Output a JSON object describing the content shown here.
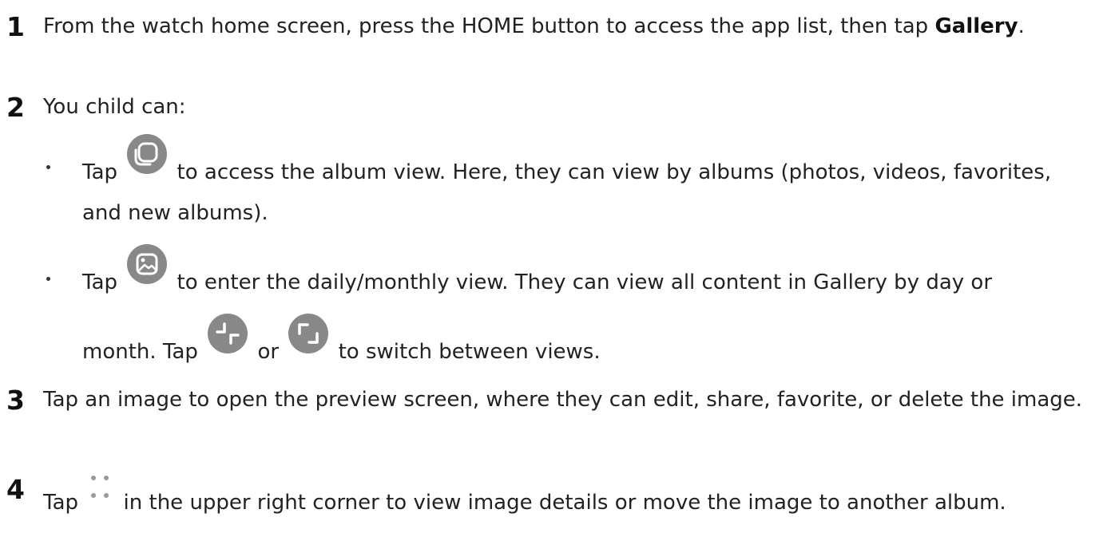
{
  "steps": [
    {
      "num": "1",
      "text_before": "From the watch home screen, press the HOME button to access the app list, then tap ",
      "bold": "Gallery",
      "text_after": "."
    },
    {
      "num": "2",
      "text": "You child can:"
    },
    {
      "num": "3",
      "text": "Tap an image to open the preview screen, where they can edit, share, favorite, or delete the image."
    },
    {
      "num": "4",
      "text_before": "Tap ",
      "text_after": " in the upper right corner to view image details or move the image to another album."
    }
  ],
  "bullets": {
    "album": {
      "tap": "Tap",
      "text": "to access the album view. Here, they can view by albums (photos, videos, favorites, and new albums)."
    },
    "daily": {
      "tap": "Tap",
      "text": "to enter the daily/monthly view. They can view all content in Gallery by day or",
      "line2_start": "month. Tap",
      "or": "or",
      "line2_end": "to switch between views."
    }
  },
  "icons": {
    "album": "album-view-icon",
    "image": "image-view-icon",
    "collapse": "collapse-view-icon",
    "expand": "expand-view-icon",
    "more": "more-options-icon"
  },
  "colors": {
    "icon_fill": "#888888",
    "icon_stroke": "#ffffff",
    "text": "#222222"
  }
}
